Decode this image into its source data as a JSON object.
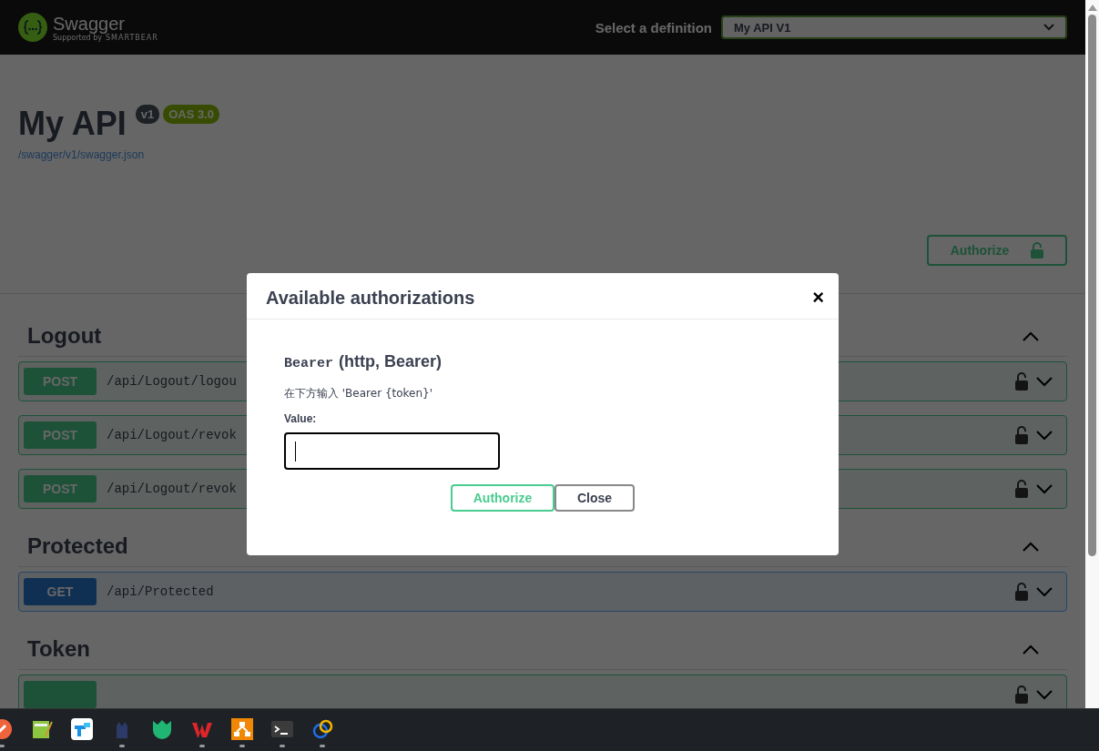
{
  "topbar": {
    "logo_name": "Swagger",
    "logo_tagline": "Supported by",
    "logo_brand": "SMARTBEAR",
    "definition_label": "Select a definition",
    "definition_value": "My API V1"
  },
  "info": {
    "title": "My API",
    "version": "v1",
    "oas": "OAS 3.0",
    "url": "/swagger/v1/swagger.json",
    "authorize_label": "Authorize"
  },
  "sections": [
    {
      "name": "Logout",
      "expanded": true,
      "operations": [
        {
          "kind": "post",
          "method": "POST",
          "path": "/api/Logout/logou"
        },
        {
          "kind": "post",
          "method": "POST",
          "path": "/api/Logout/revok"
        },
        {
          "kind": "post",
          "method": "POST",
          "path": "/api/Logout/revok"
        }
      ]
    },
    {
      "name": "Protected",
      "expanded": true,
      "operations": [
        {
          "kind": "get",
          "method": "GET",
          "path": "/api/Protected"
        }
      ]
    },
    {
      "name": "Token",
      "expanded": true,
      "operations": [
        {
          "kind": "post"
        }
      ]
    }
  ],
  "modal": {
    "title": "Available authorizations",
    "close_glyph": "×",
    "scheme_name": "Bearer",
    "scheme_type": "(http, Bearer)",
    "description": "在下方输入 'Bearer {token}'",
    "value_label": "Value:",
    "authorize_label": "Authorize",
    "close_label": "Close"
  },
  "taskbar": [
    {
      "kind": "pen",
      "running": true
    },
    {
      "kind": "notepad",
      "running": false
    },
    {
      "kind": "tiles",
      "running": false
    },
    {
      "kind": "cat",
      "running": true
    },
    {
      "kind": "tulip",
      "running": false
    },
    {
      "kind": "office",
      "running": true
    },
    {
      "kind": "diagram",
      "running": true
    },
    {
      "kind": "terminal",
      "running": true
    },
    {
      "kind": "rings",
      "running": true
    }
  ]
}
